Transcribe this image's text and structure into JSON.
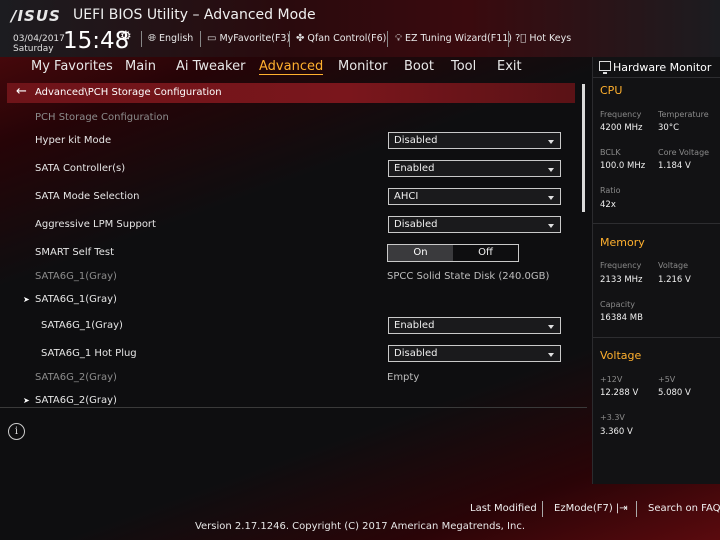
{
  "header": {
    "logo": "/ISUS",
    "title": "UEFI BIOS Utility – Advanced Mode",
    "date": "03/04/2017",
    "day": "Saturday",
    "time": "15:48",
    "items": [
      {
        "icon": "globe-icon",
        "label": "English"
      },
      {
        "icon": "favorite-icon",
        "label": "MyFavorite(F3)"
      },
      {
        "icon": "fan-icon",
        "label": "Qfan Control(F6)"
      },
      {
        "icon": "bulb-icon",
        "label": "EZ Tuning Wizard(F11)"
      },
      {
        "icon": "help-icon",
        "label": "Hot Keys"
      }
    ]
  },
  "nav": {
    "tabs": [
      "My Favorites",
      "Main",
      "Ai Tweaker",
      "Advanced",
      "Monitor",
      "Boot",
      "Tool",
      "Exit"
    ],
    "active": "Advanced"
  },
  "breadcrumb": "Advanced\\PCH Storage Configuration",
  "section_title": "PCH Storage Configuration",
  "settings": {
    "hyper_kit": {
      "label": "Hyper kit Mode",
      "value": "Disabled"
    },
    "sata_controller": {
      "label": "SATA Controller(s)",
      "value": "Enabled"
    },
    "sata_mode": {
      "label": "SATA Mode Selection",
      "value": "AHCI"
    },
    "alpm": {
      "label": "Aggressive LPM Support",
      "value": "Disabled"
    },
    "smart": {
      "label": "SMART Self Test",
      "on": "On",
      "off": "Off"
    },
    "port1_info": {
      "label": "SATA6G_1(Gray)",
      "value": "SPCC Solid State Disk (240.0GB)"
    },
    "port1_group": {
      "label": "SATA6G_1(Gray)"
    },
    "port1_enable": {
      "label": "SATA6G_1(Gray)",
      "value": "Enabled"
    },
    "port1_hotplug": {
      "label": "SATA6G_1 Hot Plug",
      "value": "Disabled"
    },
    "port2_info": {
      "label": "SATA6G_2(Gray)",
      "value": "Empty"
    },
    "port2_group": {
      "label": "SATA6G_2(Gray)"
    }
  },
  "hw_monitor": {
    "title": "Hardware Monitor",
    "cpu": {
      "heading": "CPU",
      "frequency_label": "Frequency",
      "frequency": "4200 MHz",
      "temperature_label": "Temperature",
      "temperature": "30°C",
      "bclk_label": "BCLK",
      "bclk": "100.0 MHz",
      "core_voltage_label": "Core Voltage",
      "core_voltage": "1.184 V",
      "ratio_label": "Ratio",
      "ratio": "42x"
    },
    "memory": {
      "heading": "Memory",
      "frequency_label": "Frequency",
      "frequency": "2133 MHz",
      "voltage_label": "Voltage",
      "voltage": "1.216 V",
      "capacity_label": "Capacity",
      "capacity": "16384 MB"
    },
    "voltage": {
      "heading": "Voltage",
      "v12_label": "+12V",
      "v12": "12.288 V",
      "v5_label": "+5V",
      "v5": "5.080 V",
      "v33_label": "+3.3V",
      "v33": "3.360 V"
    }
  },
  "footer": {
    "last_modified": "Last Modified",
    "ezmode": "EzMode(F7)",
    "search": "Search on FAQ",
    "copyright": "Version 2.17.1246. Copyright (C) 2017 American Megatrends, Inc."
  },
  "colors": {
    "accent": "#ffb02e",
    "breadcrumb": "#7a161c"
  }
}
